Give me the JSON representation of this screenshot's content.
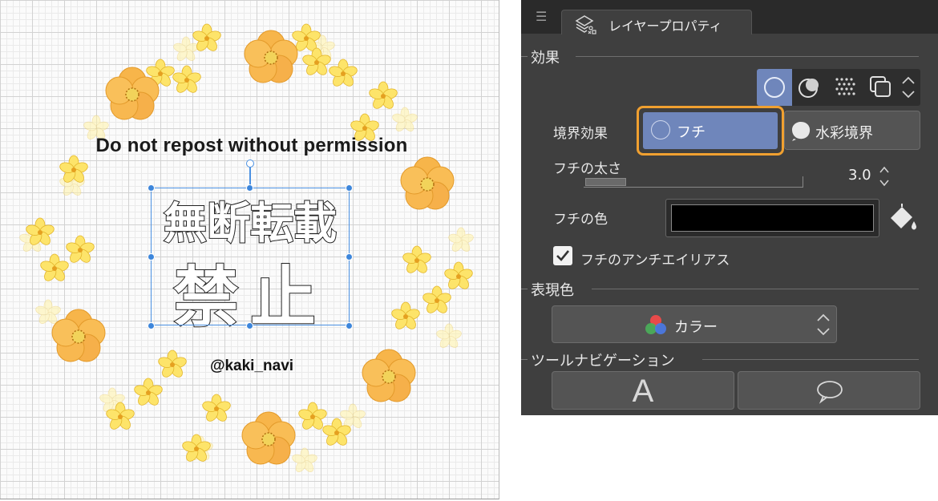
{
  "canvas": {
    "notice_text": "Do not repost without permission",
    "title_line1": "無断転載",
    "title_line2": "禁止",
    "handle": "@kaki_navi"
  },
  "panel": {
    "tab_label": "レイヤープロパティ",
    "sections": {
      "effect": "効果",
      "expression_color": "表現色",
      "tool_navigation": "ツールナビゲーション"
    },
    "border_effect": {
      "label": "境界効果",
      "option_border": "フチ",
      "option_watercolor": "水彩境界",
      "selected": "フチ"
    },
    "border_width": {
      "label": "フチの太さ",
      "value": "3.0",
      "slider_fraction": 0.19
    },
    "border_color": {
      "label": "フチの色",
      "color": "#000000"
    },
    "antialias": {
      "label": "フチのアンチエイリアス",
      "checked": true
    },
    "expression_color": {
      "selected": "カラー"
    },
    "tool_nav_buttons": [
      "A"
    ]
  },
  "colors": {
    "accent_highlight": "#f0a030",
    "active_blue": "#6f86bb",
    "panel_bg": "#3f3f3f",
    "selection_blue": "#4a90e2"
  },
  "icons": {
    "effect_buttons": [
      "circle-icon",
      "tone-icon",
      "halftone-dots-icon",
      "layer-stack-icon"
    ],
    "tab": "layer-property-icon",
    "color_well": "paint-bucket-icon",
    "expression": "rgb-circles-icon",
    "tool_nav": [
      "text-tool-icon",
      "speech-bubble-icon"
    ]
  }
}
